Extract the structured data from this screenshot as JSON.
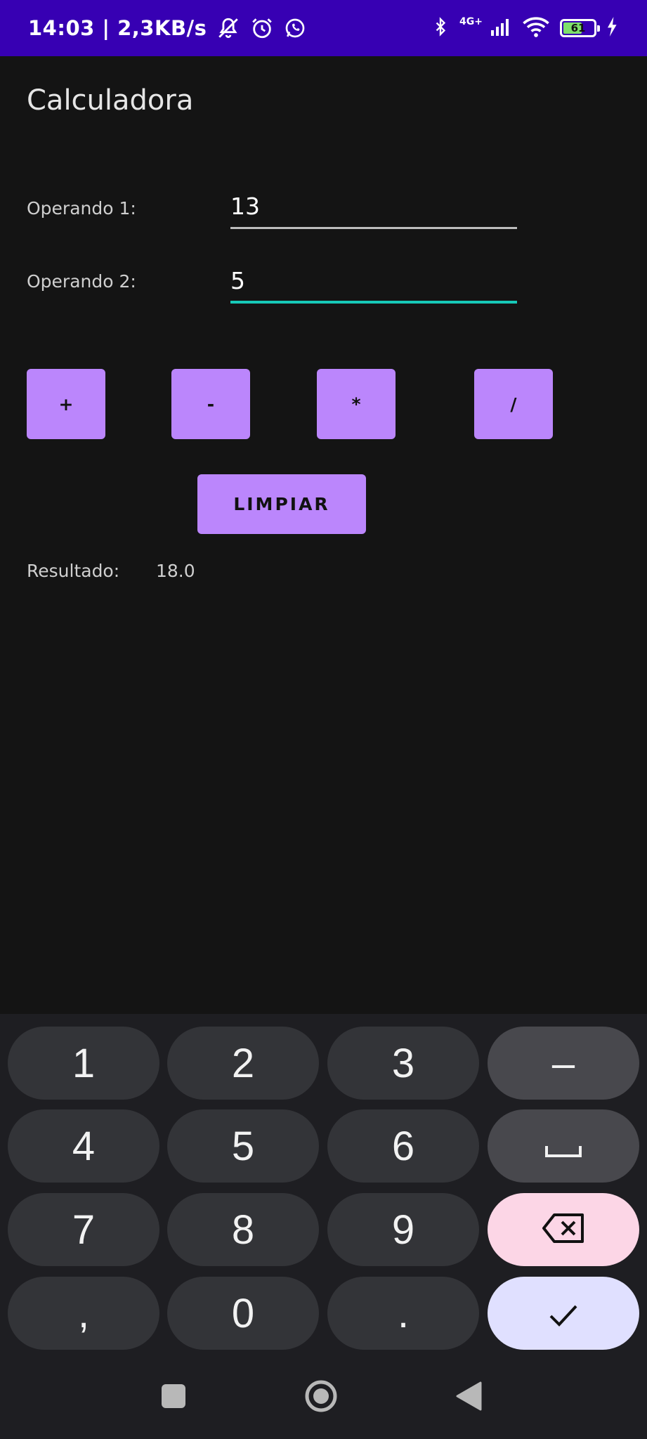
{
  "status_bar": {
    "time_info": "14:03 | 2,3KB/s",
    "network_label": "4G+",
    "battery_level": "61",
    "icons": [
      "mute-notifications-icon",
      "alarm-icon",
      "whatsapp-icon",
      "bluetooth-icon",
      "signal-icon",
      "wifi-icon",
      "battery-icon",
      "charging-icon"
    ],
    "background": "#3700b3"
  },
  "app": {
    "title": "Calculadora",
    "operand1": {
      "label": "Operando 1:",
      "value": "13"
    },
    "operand2": {
      "label": "Operando 2:",
      "value": "5"
    },
    "operators": [
      "+",
      "-",
      "*",
      "/"
    ],
    "clear_label": "LIMPIAR",
    "result_label": "Resultado:",
    "result_value": "18.0",
    "accent_color": "#bb86fc",
    "focus_color": "#17c9b8"
  },
  "keyboard": {
    "keys": {
      "k1": "1",
      "k2": "2",
      "k3": "3",
      "minus": "–",
      "k4": "4",
      "k5": "5",
      "k6": "6",
      "k7": "7",
      "k8": "8",
      "k9": "9",
      "comma": ",",
      "k0": "0",
      "period": "."
    },
    "icons": [
      "space-icon",
      "backspace-icon",
      "checkmark-icon"
    ]
  },
  "nav_bar": {
    "icons": [
      "recent-apps-icon",
      "home-icon",
      "back-icon"
    ]
  }
}
